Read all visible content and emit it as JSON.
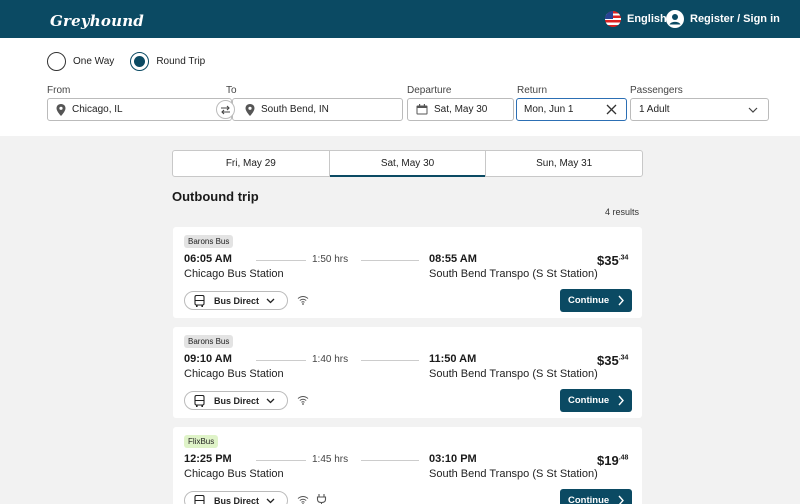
{
  "header": {
    "logo_text": "Greyhound",
    "language": "English",
    "signin": "Register / Sign in"
  },
  "trip_type": {
    "one_way": "One Way",
    "round_trip": "Round Trip",
    "selected": "Round Trip"
  },
  "search": {
    "from_label": "From",
    "from_value": "Chicago, IL",
    "to_label": "To",
    "to_value": "South Bend, IN",
    "departure_label": "Departure",
    "departure_value": "Sat, May 30",
    "return_label": "Return",
    "return_value": "Mon, Jun 1",
    "passengers_label": "Passengers",
    "passengers_value": "1 Adult"
  },
  "date_tabs": [
    {
      "label": "Fri, May 29"
    },
    {
      "label": "Sat, May 30"
    },
    {
      "label": "Sun, May 31"
    }
  ],
  "outbound": {
    "title": "Outbound trip",
    "results": "4 results"
  },
  "trips": [
    {
      "carrier": "Barons Bus",
      "dep_time": "06:05 AM",
      "dep_station": "Chicago Bus Station",
      "duration": "1:50 hrs",
      "arr_time": "08:55 AM",
      "arr_station": "South Bend Transpo (S St Station)",
      "price_main": "$35",
      "price_cents": ".34",
      "service": "Bus Direct",
      "continue": "Continue"
    },
    {
      "carrier": "Barons Bus",
      "dep_time": "09:10 AM",
      "dep_station": "Chicago Bus Station",
      "duration": "1:40 hrs",
      "arr_time": "11:50 AM",
      "arr_station": "South Bend Transpo (S St Station)",
      "price_main": "$35",
      "price_cents": ".34",
      "service": "Bus Direct",
      "continue": "Continue"
    },
    {
      "carrier": "FlixBus",
      "dep_time": "12:25 PM",
      "dep_station": "Chicago Bus Station",
      "duration": "1:45 hrs",
      "arr_time": "03:10 PM",
      "arr_station": "South Bend Transpo (S St Station)",
      "price_main": "$19",
      "price_cents": ".48",
      "service": "Bus Direct",
      "continue": "Continue"
    }
  ],
  "colors": {
    "brand": "#0b4a63",
    "active_border": "#2c6fb4",
    "flix_badge": "#dff3c8"
  }
}
